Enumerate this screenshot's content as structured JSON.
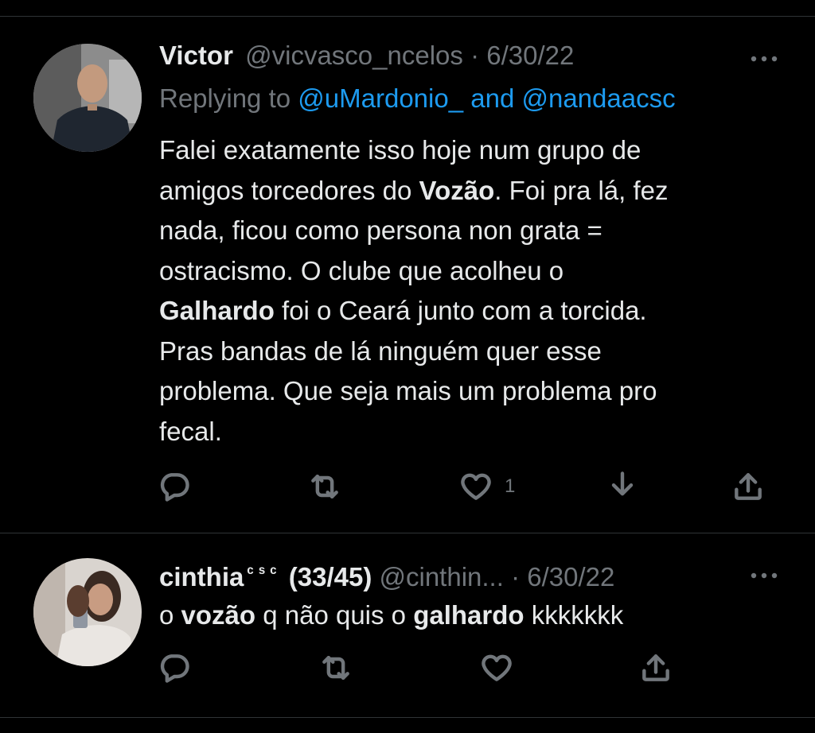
{
  "tweets": [
    {
      "name": "Victor",
      "handle": "@vicvasco_ncelos",
      "separator": "·",
      "date": "6/30/22",
      "replying_prefix": "Replying to",
      "replying_user1": "@uMardonio_",
      "replying_and": "and",
      "replying_user2": "@nandaacsc",
      "text_lines": [
        "Falei exatamente isso hoje num grupo de",
        "amigos torcedores do",
        "Vozão",
        ". Foi pra lá, fez",
        "nada, ficou como persona non grata =",
        "ostracismo. O clube que acolheu o",
        "Galhardo",
        " foi o Ceará junto com a torcida.",
        "Pras bandas de lá ninguém quer esse",
        "problema. Que seja mais um problema pro",
        "fecal."
      ],
      "like_count": "1",
      "icons": [
        "reply-icon",
        "retweet-icon",
        "like-icon",
        "download-icon",
        "share-icon"
      ],
      "avatar_colors": {
        "bg": "#9a9a9a",
        "shirt": "#1f2630",
        "skin": "#c39a7e"
      }
    },
    {
      "name": "cinthia",
      "name_suffix": "ᶜ ˢ ᶜ",
      "name_extra": "(33/45)",
      "handle": "@cinthin...",
      "separator": "·",
      "date": "6/30/22",
      "text_parts": [
        "o ",
        "vozão",
        " q não quis o ",
        "galhardo",
        " kkkkkkk"
      ],
      "icons": [
        "reply-icon",
        "retweet-icon",
        "like-icon",
        "share-icon"
      ],
      "avatar_colors": {
        "bg": "#d9d4cf",
        "hair": "#3a2a22",
        "shirt": "#eae6e2"
      }
    }
  ],
  "colors": {
    "background": "#000000",
    "text": "#e7e9ea",
    "muted": "#71767b",
    "link": "#1d9bf0",
    "divider": "#2f3336"
  }
}
